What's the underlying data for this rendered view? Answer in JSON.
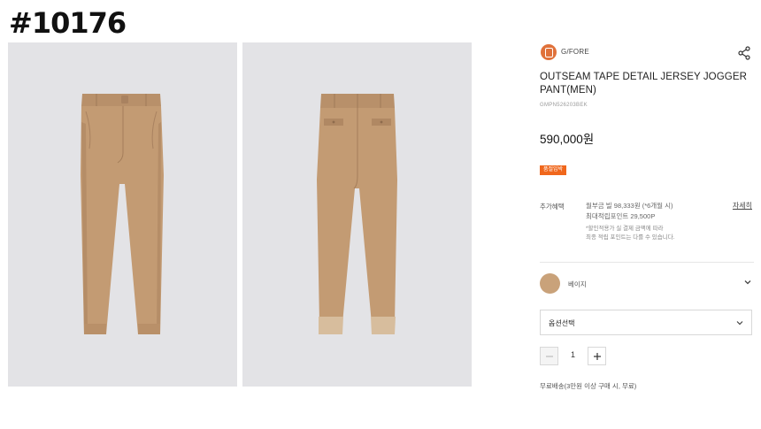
{
  "tag": "#10176",
  "brand": {
    "name": "G/FORE"
  },
  "product": {
    "title": "OUTSEAM TAPE DETAIL JERSEY JOGGER PANT(MEN)",
    "sku": "GMPN526203BEK",
    "price": "590,000원",
    "badge": "품절임박"
  },
  "benefits": {
    "label": "추가혜택",
    "installment": "월부금 빌 98,333원 (*6개월 시)",
    "points": "최대적립포인트 29,500P",
    "note_line1": "*할인적용가 실 결제 금액에 따라",
    "note_line2": "최종 적립 포인트는 다를 수 있습니다.",
    "detail_link": "자세히"
  },
  "color_option": {
    "name": "베이지",
    "swatch": "#c9a27a"
  },
  "option_select": {
    "label": "옵션선택"
  },
  "quantity": {
    "value": "1"
  },
  "shipping": "무료배송(3만원 이상 구매 시, 무료)",
  "icons": {
    "share": "share-icon",
    "chevron": "chevron-down-icon",
    "minus": "minus-icon",
    "plus": "plus-icon"
  },
  "colors": {
    "pant": "#c39b73",
    "photo_bg": "#e3e3e6",
    "badge": "#f0671c",
    "brand_logo": "#e0713a"
  }
}
